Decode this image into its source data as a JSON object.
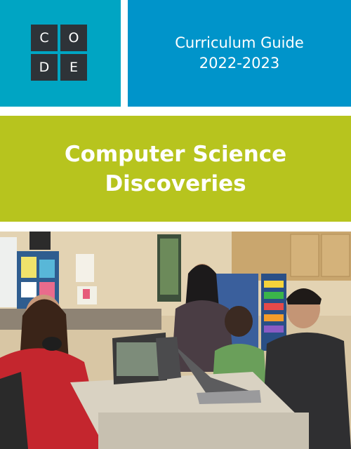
{
  "logo": {
    "letters": [
      "C",
      "O",
      "D",
      "E"
    ]
  },
  "header": {
    "subtitle": "Curriculum Guide",
    "years": "2022-2023"
  },
  "course": {
    "line1": "Computer Science",
    "line2": "Discoveries"
  },
  "colors": {
    "logo_panel": "#00a5c3",
    "title_panel": "#0094ca",
    "green_band": "#b7c41e",
    "logo_tile": "#2e3338"
  }
}
